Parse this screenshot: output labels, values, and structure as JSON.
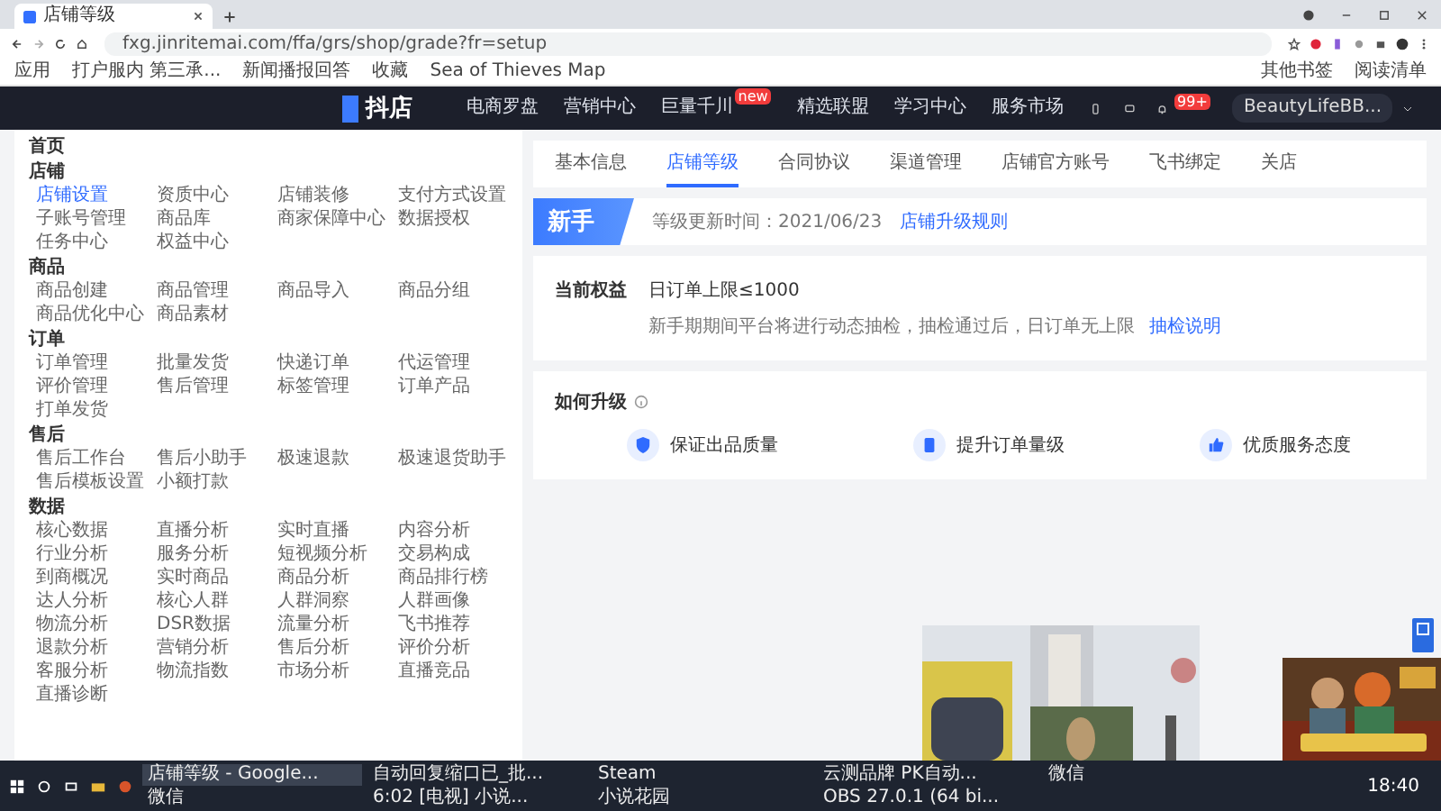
{
  "browser": {
    "tab_title": "店铺等级",
    "url": "fxg.jinritemai.com/ffa/grs/shop/grade?fr=setup",
    "bookmarks": [
      "应用",
      "打户服内 第三承...",
      "新闻播报回答",
      "收藏",
      "Sea of Thieves Map"
    ],
    "bookmarks_right": [
      "其他书签",
      "阅读清单"
    ]
  },
  "header": {
    "logo": "抖店",
    "nav": [
      {
        "label": "电商罗盘"
      },
      {
        "label": "营销中心"
      },
      {
        "label": "巨量千川",
        "badge": "new"
      },
      {
        "label": "精选联盟"
      },
      {
        "label": "学习中心"
      },
      {
        "label": "服务市场"
      }
    ],
    "notification_badge": "99+",
    "user": "BeautyLifeBB..."
  },
  "sidebar": {
    "home": "首页",
    "sections": [
      {
        "title": "店铺",
        "items": [
          {
            "label": "店铺设置",
            "selected": true
          },
          {
            "label": "资质中心",
            "selected": false
          },
          {
            "label": "店铺装修",
            "selected": false
          },
          {
            "label": "支付方式设置",
            "selected": false
          },
          {
            "label": "子账号管理",
            "selected": false
          },
          {
            "label": "商品库",
            "selected": false
          },
          {
            "label": "商家保障中心",
            "selected": false
          },
          {
            "label": "数据授权",
            "selected": false
          },
          {
            "label": "任务中心",
            "selected": false
          },
          {
            "label": "权益中心",
            "selected": false
          }
        ]
      },
      {
        "title": "商品",
        "items": [
          {
            "label": "商品创建",
            "selected": false
          },
          {
            "label": "商品管理",
            "selected": false
          },
          {
            "label": "商品导入",
            "selected": false
          },
          {
            "label": "商品分组",
            "selected": false
          },
          {
            "label": "商品优化中心",
            "selected": false
          },
          {
            "label": "商品素材",
            "selected": false
          }
        ]
      },
      {
        "title": "订单",
        "items": [
          {
            "label": "订单管理",
            "selected": false
          },
          {
            "label": "批量发货",
            "selected": false
          },
          {
            "label": "快递订单",
            "selected": false
          },
          {
            "label": "代运管理",
            "selected": false
          },
          {
            "label": "评价管理",
            "selected": false
          },
          {
            "label": "售后管理",
            "selected": false
          },
          {
            "label": "标签管理",
            "selected": false
          },
          {
            "label": "订单产品",
            "selected": false
          },
          {
            "label": "打单发货",
            "selected": false
          }
        ]
      },
      {
        "title": "售后",
        "items": [
          {
            "label": "售后工作台",
            "selected": false
          },
          {
            "label": "售后小助手",
            "selected": false
          },
          {
            "label": "极速退款",
            "selected": false
          },
          {
            "label": "极速退货助手",
            "selected": false
          },
          {
            "label": "售后模板设置",
            "selected": false
          },
          {
            "label": "小额打款",
            "selected": false
          }
        ]
      },
      {
        "title": "数据",
        "items": [
          {
            "label": "核心数据",
            "selected": false
          },
          {
            "label": "直播分析",
            "selected": false
          },
          {
            "label": "实时直播",
            "selected": false
          },
          {
            "label": "内容分析",
            "selected": false
          },
          {
            "label": "行业分析",
            "selected": false
          },
          {
            "label": "服务分析",
            "selected": false
          },
          {
            "label": "短视频分析",
            "selected": false
          },
          {
            "label": "交易构成",
            "selected": false
          },
          {
            "label": "到商概况",
            "selected": false
          },
          {
            "label": "实时商品",
            "selected": false
          },
          {
            "label": "商品分析",
            "selected": false
          },
          {
            "label": "商品排行榜",
            "selected": false
          },
          {
            "label": "达人分析",
            "selected": false
          },
          {
            "label": "核心人群",
            "selected": false
          },
          {
            "label": "人群洞察",
            "selected": false
          },
          {
            "label": "人群画像",
            "selected": false
          },
          {
            "label": "物流分析",
            "selected": false
          },
          {
            "label": "DSR数据",
            "selected": false
          },
          {
            "label": "流量分析",
            "selected": false
          },
          {
            "label": "飞书推荐",
            "selected": false
          },
          {
            "label": "退款分析",
            "selected": false
          },
          {
            "label": "营销分析",
            "selected": false
          },
          {
            "label": "售后分析",
            "selected": false
          },
          {
            "label": "评价分析",
            "selected": false
          },
          {
            "label": "客服分析",
            "selected": false
          },
          {
            "label": "物流指数",
            "selected": false
          },
          {
            "label": "市场分析",
            "selected": false
          },
          {
            "label": "直播竞品",
            "selected": false
          },
          {
            "label": "直播诊断",
            "selected": false
          }
        ]
      }
    ]
  },
  "tabs": [
    {
      "label": "基本信息",
      "selected": false
    },
    {
      "label": "店铺等级",
      "selected": true
    },
    {
      "label": "合同协议",
      "selected": false
    },
    {
      "label": "渠道管理",
      "selected": false
    },
    {
      "label": "店铺官方账号",
      "selected": false
    },
    {
      "label": "飞书绑定",
      "selected": false
    },
    {
      "label": "关店",
      "selected": false
    }
  ],
  "level_banner": {
    "badge": "新手",
    "text": "等级更新时间：2021/06/23",
    "link": "店铺升级规则"
  },
  "benefits": {
    "label": "当前权益",
    "value": "日订单上限≤1000",
    "note": "新手期期间平台将进行动态抽检，抽检通过后，日订单无上限",
    "link": "抽检说明"
  },
  "upgrade": {
    "title": "如何升级",
    "items": [
      "保证出品质量",
      "提升订单量级",
      "优质服务态度"
    ]
  },
  "taskbar": {
    "items": [
      {
        "label": "店铺等级 - Google...",
        "active": true
      },
      {
        "label": "自动回复缩口已_批...",
        "active": false
      },
      {
        "label": "Steam",
        "active": false
      },
      {
        "label": "云测品牌 PK自动...",
        "active": false
      },
      {
        "label": "微信",
        "active": false
      },
      {
        "label": "微信",
        "active": false
      },
      {
        "label": "6:02 [电视] 小说...",
        "active": false
      },
      {
        "label": "小说花园",
        "active": false
      },
      {
        "label": "OBS 27.0.1 (64 bi...",
        "active": false
      }
    ],
    "time": "18:40"
  }
}
